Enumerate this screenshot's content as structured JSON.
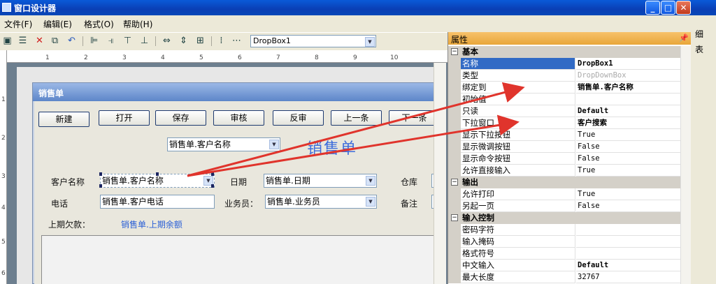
{
  "window": {
    "title": "窗口设计器"
  },
  "menu": [
    "文件(F)",
    "编辑(E)",
    "格式(O)",
    "帮助(H)"
  ],
  "toolbar": {
    "control_select": "DropBox1"
  },
  "ruler": [
    "1",
    "2",
    "3",
    "4",
    "5",
    "6",
    "7",
    "8",
    "9",
    "10"
  ],
  "ruler_v": [
    "1",
    "2",
    "3",
    "4",
    "5",
    "6"
  ],
  "form": {
    "title": "销售单",
    "buttons": [
      "新建",
      "打开",
      "保存",
      "审核",
      "反审",
      "上一条",
      "下一条"
    ],
    "bind_combo": "销售单.客户名称",
    "big_title": "销售单",
    "labels": {
      "customer": "客户名称",
      "date": "日期",
      "warehouse": "仓库",
      "phone": "电话",
      "salesman": "业务员：",
      "note": "备注",
      "last_due": "上期欠款："
    },
    "fields": {
      "customer": "销售单.客户名称",
      "date": "销售单.日期",
      "phone": "销售单.客户电话",
      "salesman": "销售单.业务员",
      "last_due": "销售单.上期余额"
    }
  },
  "side": [
    "细",
    "表"
  ],
  "properties": {
    "header": "属性",
    "rows": [
      {
        "type": "cat",
        "name": "基本"
      },
      {
        "name": "名称",
        "value": "DropBox1",
        "selected": true,
        "bold": true
      },
      {
        "name": "类型",
        "value": "DropDownBox",
        "gray": true
      },
      {
        "name": "绑定到",
        "value": "销售单.客户名称",
        "bold": true
      },
      {
        "name": "初始值",
        "value": ""
      },
      {
        "name": "只读",
        "value": "Default",
        "bold": true
      },
      {
        "name": "下拉窗口",
        "value": "客户搜索",
        "bold": true
      },
      {
        "name": "显示下拉按钮",
        "value": "True"
      },
      {
        "name": "显示微调按钮",
        "value": "False"
      },
      {
        "name": "显示命令按钮",
        "value": "False"
      },
      {
        "name": "允许直接输入",
        "value": "True"
      },
      {
        "type": "cat",
        "name": "输出"
      },
      {
        "name": "允许打印",
        "value": "True"
      },
      {
        "name": "另起一页",
        "value": "False"
      },
      {
        "type": "cat",
        "name": "输入控制"
      },
      {
        "name": "密码字符",
        "value": ""
      },
      {
        "name": "输入掩码",
        "value": ""
      },
      {
        "name": "格式符号",
        "value": ""
      },
      {
        "name": "中文输入",
        "value": "Default",
        "bold": true
      },
      {
        "name": "最大长度",
        "value": "32767"
      }
    ]
  },
  "colors": {
    "title_blue": "#0a4fd0",
    "arrow_red": "#e0342c",
    "selection": "#316ac5",
    "props_header": "#f0b24e"
  }
}
